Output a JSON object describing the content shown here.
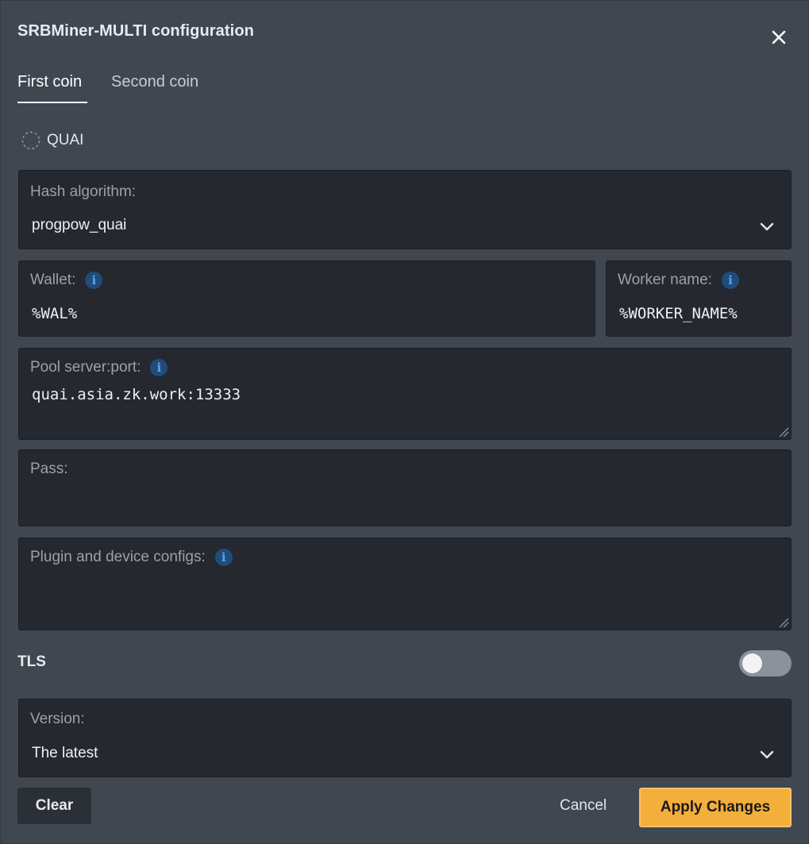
{
  "dialog": {
    "title": "SRBMiner-MULTI configuration"
  },
  "tabs": [
    {
      "label": "First coin",
      "active": true
    },
    {
      "label": "Second coin",
      "active": false
    }
  ],
  "coin": {
    "name": "QUAI",
    "icon": "dashed-circle-icon"
  },
  "fields": {
    "hash_algorithm": {
      "label": "Hash algorithm:",
      "value": "progpow_quai"
    },
    "wallet": {
      "label": "Wallet:",
      "value": "%WAL%"
    },
    "worker_name": {
      "label": "Worker name:",
      "value": "%WORKER_NAME%"
    },
    "pool": {
      "label": "Pool server:port:",
      "value": "quai.asia.zk.work:13333"
    },
    "pass": {
      "label": "Pass:",
      "value": ""
    },
    "plugin": {
      "label": "Plugin and device configs:",
      "value": ""
    },
    "version": {
      "label": "Version:",
      "value": "The latest"
    }
  },
  "info_glyph": "i",
  "tls": {
    "label": "TLS",
    "enabled": false
  },
  "buttons": {
    "clear": "Clear",
    "cancel": "Cancel",
    "apply": "Apply Changes"
  },
  "colors": {
    "background": "#414751",
    "field_background": "#25282e",
    "accent": "#f4ae3a",
    "info": "#5aa5ea"
  }
}
